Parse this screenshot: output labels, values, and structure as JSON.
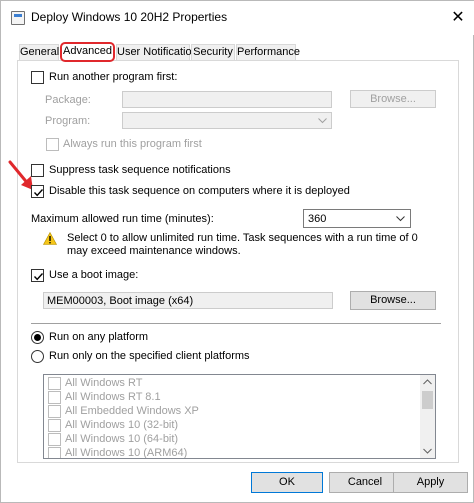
{
  "window": {
    "title": "Deploy Windows 10 20H2 Properties",
    "close_glyph": "✕"
  },
  "tabs": [
    {
      "label": "General",
      "active": false
    },
    {
      "label": "Advanced",
      "active": true
    },
    {
      "label": "User Notification",
      "active": false
    },
    {
      "label": "Security",
      "active": false
    },
    {
      "label": "Performance",
      "active": false
    }
  ],
  "run_another": {
    "label": "Run another program first:",
    "checked": false,
    "package_label": "Package:",
    "package_value": "",
    "browse_label": "Browse...",
    "program_label": "Program:",
    "program_value": "",
    "always_run_label": "Always run this program first"
  },
  "options": {
    "suppress_label": "Suppress task sequence notifications",
    "suppress_checked": false,
    "disable_label": "Disable this task sequence on computers where it is deployed",
    "disable_checked": true
  },
  "runtime": {
    "label": "Maximum allowed run time (minutes):",
    "value": "360",
    "warning": "Select 0 to allow unlimited run time. Task sequences with a run time of 0 may exceed maintenance windows."
  },
  "boot_image": {
    "label": "Use a boot image:",
    "checked": true,
    "value": "MEM00003, Boot image (x64)",
    "browse_label": "Browse..."
  },
  "platform": {
    "any_label": "Run on any platform",
    "any_selected": true,
    "specified_label": "Run only on the specified client platforms",
    "specified_selected": false,
    "items": [
      "All Windows RT",
      "All Windows RT 8.1",
      "All Embedded Windows XP",
      "All Windows 10 (32-bit)",
      "All Windows 10 (64-bit)",
      "All Windows 10 (ARM64)"
    ]
  },
  "footer": {
    "ok_label": "OK",
    "cancel_label": "Cancel",
    "apply_label": "Apply"
  },
  "colors": {
    "annotation_red": "#e0282c",
    "warning_yellow": "#f5c518",
    "accent_blue": "#0078d7"
  }
}
